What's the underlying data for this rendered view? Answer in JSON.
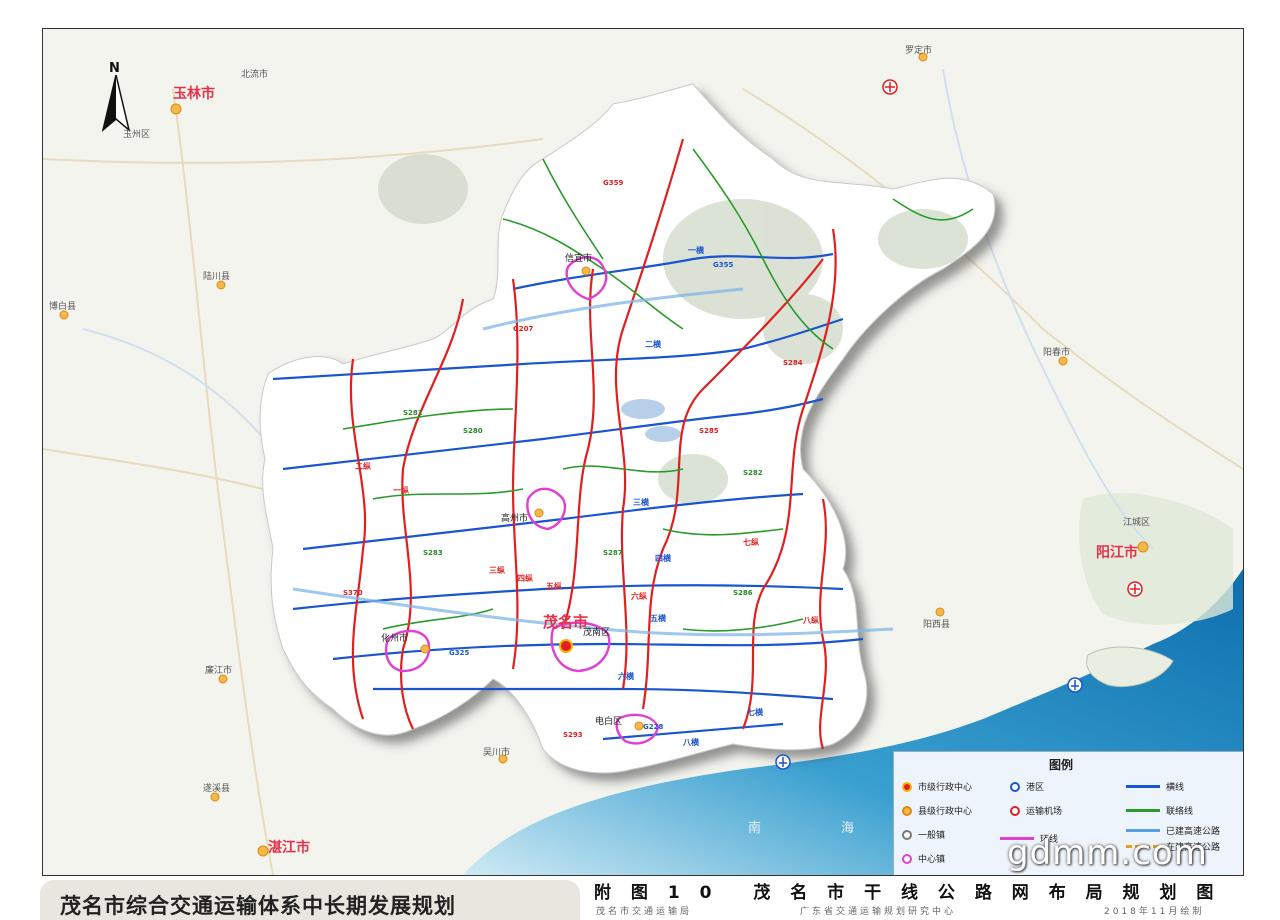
{
  "map": {
    "compass_label": "N",
    "cities_major": [
      {
        "name": "玉林市"
      },
      {
        "name": "阳江市"
      },
      {
        "name": "湛江市"
      },
      {
        "name": "茂名市"
      }
    ],
    "county_labels": [
      "信宜市",
      "高州市",
      "化州市",
      "电白区",
      "茂南区"
    ],
    "neighbor_labels": [
      "北流市",
      "玉州区",
      "博白县",
      "陆川县",
      "廉江市",
      "遂溪县",
      "吴川市",
      "罗定市",
      "阳春市",
      "阳西县",
      "江城区"
    ],
    "sea_labels": [
      "南",
      "海"
    ],
    "corridor_labels": {
      "horizontal": [
        "一横",
        "二横",
        "三横",
        "四横",
        "五横",
        "六横",
        "七横",
        "八横"
      ],
      "vertical": [
        "一纵",
        "二纵",
        "三纵",
        "四纵",
        "五纵",
        "六纵",
        "七纵",
        "八纵"
      ]
    },
    "road_codes": [
      "G359",
      "G355",
      "G325",
      "G228",
      "G207",
      "S280",
      "S281",
      "S285",
      "S286",
      "S293",
      "S370",
      "S282",
      "S283",
      "S284",
      "S287"
    ]
  },
  "legend": {
    "title": "图例",
    "items": [
      {
        "label": "市级行政中心",
        "symbol": "city-center"
      },
      {
        "label": "县级行政中心",
        "symbol": "county-center"
      },
      {
        "label": "一般镇",
        "symbol": "town"
      },
      {
        "label": "中心镇",
        "symbol": "central-town"
      },
      {
        "label": "港区",
        "symbol": "port"
      },
      {
        "label": "运输机场",
        "symbol": "airport"
      },
      {
        "label": "环线",
        "symbol": "ring-line"
      },
      {
        "label": "横线",
        "symbol": "horizontal-line"
      },
      {
        "label": "联络线",
        "symbol": "link-line"
      },
      {
        "label": "已建高速公路",
        "symbol": "expressway-built"
      },
      {
        "label": "在建高速公路",
        "symbol": "expressway-building"
      }
    ]
  },
  "watermark": "gdmm.com",
  "footer": {
    "left_title": "茂名市综合交通运输体系中长期发展规划",
    "figure_no": "附 图 1 0",
    "figure_title": "茂 名 市 干 线 公 路 网 布 局 规 划 图",
    "sub_left": "茂名市交通运输局",
    "sub_mid": "广东省交通运输规划研究中心",
    "sub_right": "2018年11月绘制"
  },
  "colors": {
    "horizontal": "#1a55d0",
    "vertical": "#e02020",
    "link": "#2a9a2a",
    "ring": "#e040d0",
    "expressway": "#5aa0e0",
    "sea": "#1f8fc8"
  }
}
